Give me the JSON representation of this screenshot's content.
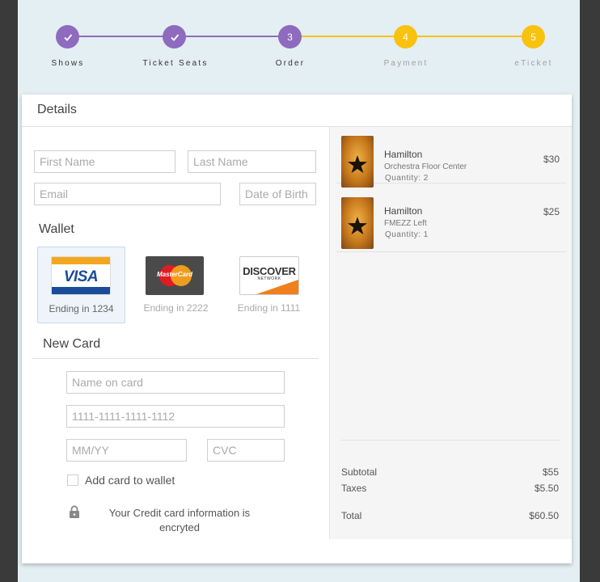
{
  "stepper": {
    "steps": [
      {
        "label": "Shows",
        "value": "✓",
        "state": "done"
      },
      {
        "label": "Ticket Seats",
        "value": "✓",
        "state": "done"
      },
      {
        "label": "Order",
        "value": "3",
        "state": "current"
      },
      {
        "label": "Payment",
        "value": "4",
        "state": "pending"
      },
      {
        "label": "eTicket",
        "value": "5",
        "state": "pending"
      }
    ],
    "colors": {
      "done": "#8e6bbf",
      "pending": "#f8c20e",
      "label_done": "#333333",
      "label_pending": "#a0a0a0"
    }
  },
  "details": {
    "title": "Details",
    "first_name_placeholder": "First Name",
    "last_name_placeholder": "Last Name",
    "email_placeholder": "Email",
    "dob_placeholder": "Date of Birth"
  },
  "wallet": {
    "title": "Wallet",
    "cards": [
      {
        "brand": "VISA",
        "ending": "Ending in 1234",
        "selected": true
      },
      {
        "brand": "MasterCard",
        "ending": "Ending in 2222",
        "selected": false
      },
      {
        "brand": "DISCOVER",
        "sub": "NETWORK",
        "ending": "Ending in 1111",
        "selected": false
      }
    ]
  },
  "new_card": {
    "title": "New Card",
    "name_placeholder": "Name on card",
    "number_placeholder": "1111-1111-1111-1112",
    "expiry_placeholder": "MM/YY",
    "cvc_placeholder": "CVC",
    "save_label": "Add card to wallet",
    "secure_note": "Your Credit card information is encryted"
  },
  "order": {
    "items": [
      {
        "title": "Hamilton",
        "seat": "Orchestra Floor Center",
        "quantity": "Quantity: 2",
        "price": "$30"
      },
      {
        "title": "Hamilton",
        "seat": "FMEZZ Left",
        "quantity": "Quantity: 1",
        "price": "$25"
      }
    ],
    "subtotal_label": "Subtotal",
    "subtotal": "$55",
    "taxes_label": "Taxes",
    "taxes": "$5.50",
    "total_label": "Total",
    "total": "$60.50"
  }
}
